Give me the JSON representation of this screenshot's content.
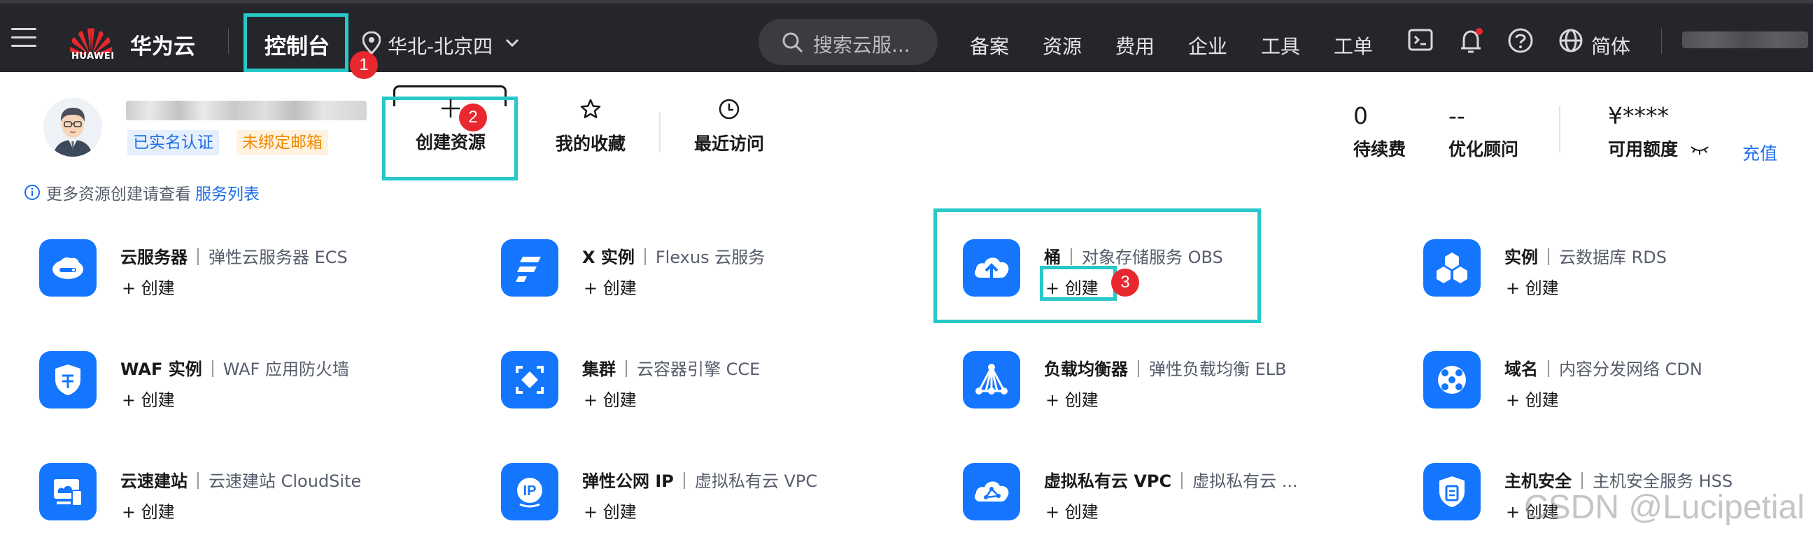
{
  "topbar": {
    "logo_text": "HUAWEI",
    "brand": "华为云",
    "console": "控制台",
    "region": "华北-北京四",
    "search_placeholder": "搜索云服...",
    "nav": [
      "备案",
      "资源",
      "费用",
      "企业",
      "工具",
      "工单"
    ],
    "language": "简体"
  },
  "annotations": {
    "step1": "1",
    "step2": "2",
    "step3": "3"
  },
  "profile": {
    "tag_verified": "已实名认证",
    "tag_email": "未绑定邮箱"
  },
  "quick_actions": {
    "create": "创建资源",
    "favorites": "我的收藏",
    "recent": "最近访问"
  },
  "stats": {
    "renewal_value": "0",
    "renewal_label": "待续费",
    "advisor_value": "--",
    "advisor_label": "优化顾问",
    "quota_value": "¥****",
    "quota_label": "可用额度",
    "recharge": "充值"
  },
  "tip": {
    "text": "更多资源创建请查看",
    "link": "服务列表"
  },
  "services": [
    {
      "name": "云服务器",
      "desc": "弹性云服务器 ECS",
      "icon": "ecs-icon",
      "create": "+ 创建"
    },
    {
      "name": "X 实例",
      "desc": "Flexus 云服务",
      "icon": "flexus-icon",
      "create": "+ 创建"
    },
    {
      "name": "桶",
      "desc": "对象存储服务 OBS",
      "icon": "obs-cloud-upload-icon",
      "create": "+ 创建"
    },
    {
      "name": "实例",
      "desc": "云数据库 RDS",
      "icon": "rds-cubes-icon",
      "create": "+ 创建"
    },
    {
      "name": "WAF 实例",
      "desc": "WAF 应用防火墙",
      "icon": "waf-shield-icon",
      "create": "+ 创建"
    },
    {
      "name": "集群",
      "desc": "云容器引擎 CCE",
      "icon": "cce-icon",
      "create": "+ 创建"
    },
    {
      "name": "负载均衡器",
      "desc": "弹性负载均衡 ELB",
      "icon": "elb-icon",
      "create": "+ 创建"
    },
    {
      "name": "域名",
      "desc": "内容分发网络 CDN",
      "icon": "cdn-icon",
      "create": "+ 创建"
    },
    {
      "name": "云速建站",
      "desc": "云速建站 CloudSite",
      "icon": "cloudsite-icon",
      "create": "+ 创建"
    },
    {
      "name": "弹性公网 IP",
      "desc": "虚拟私有云 VPC",
      "icon": "eip-icon",
      "create": "+ 创建"
    },
    {
      "name": "虚拟私有云 VPC",
      "desc": "虚拟私有云 ...",
      "icon": "vpc-icon",
      "create": "+ 创建"
    },
    {
      "name": "主机安全",
      "desc": "主机安全服务 HSS",
      "icon": "hss-shield-icon",
      "create": "+ 创建"
    }
  ],
  "watermark": "CSDN @Lucipetial",
  "colors": {
    "accent": "#1476ff",
    "highlight": "#28c8c8",
    "badge": "#e8282e",
    "topbar": "#24262b"
  }
}
